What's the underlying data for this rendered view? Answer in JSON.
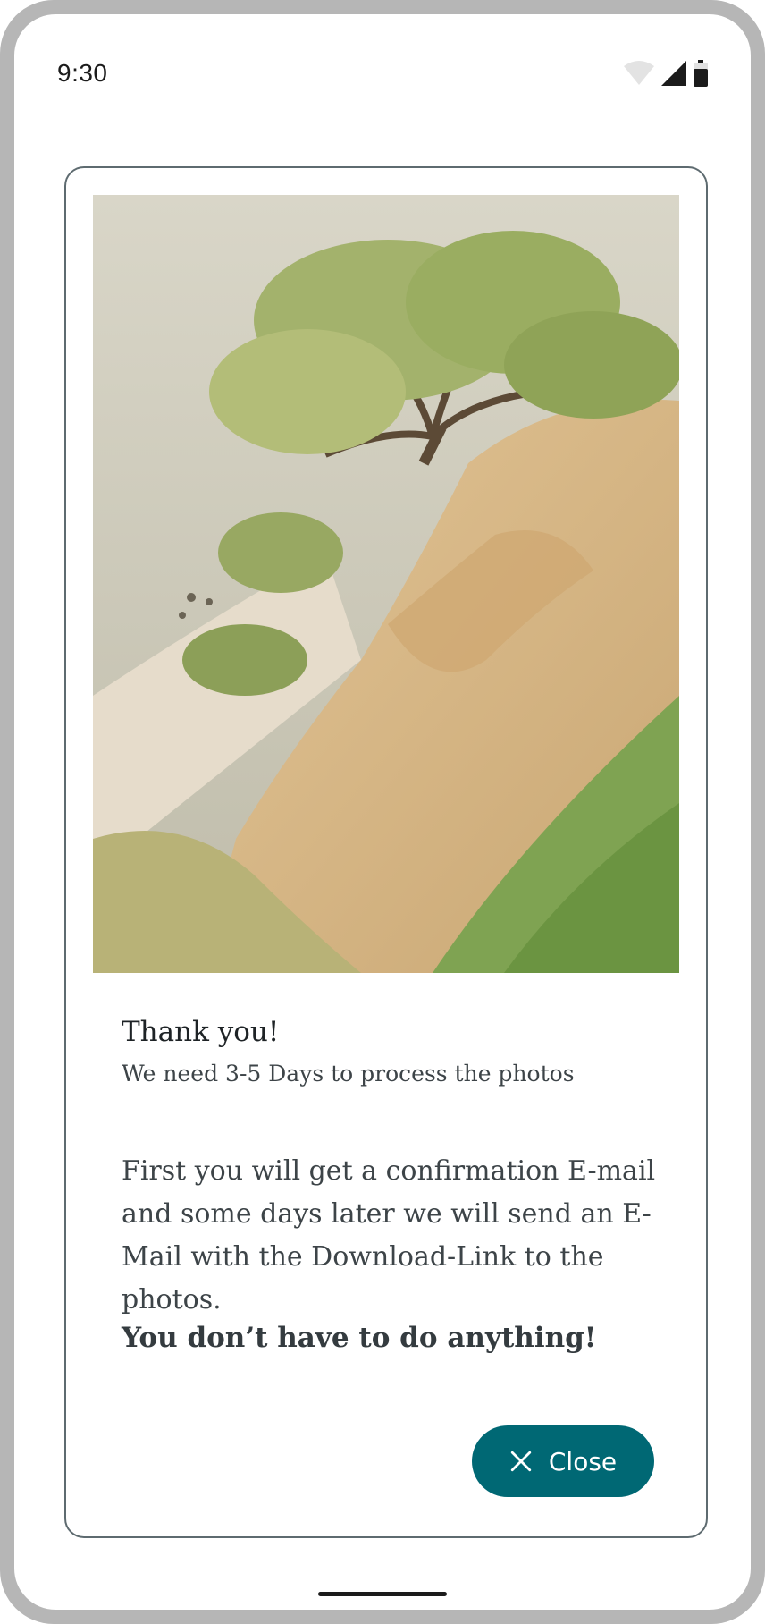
{
  "status_bar": {
    "time": "9:30"
  },
  "dialog": {
    "title": "Thank you!",
    "subtitle": "We need 3-5 Days to process the photos",
    "body": "First you will get a confirmation E-mail and some days later we will send an E-Mail with the Download-Link to the photos.",
    "emphasis": "You don’t have to do anything!",
    "close_label": "Close",
    "close_icon": "close-icon",
    "accent_color": "#006874"
  }
}
